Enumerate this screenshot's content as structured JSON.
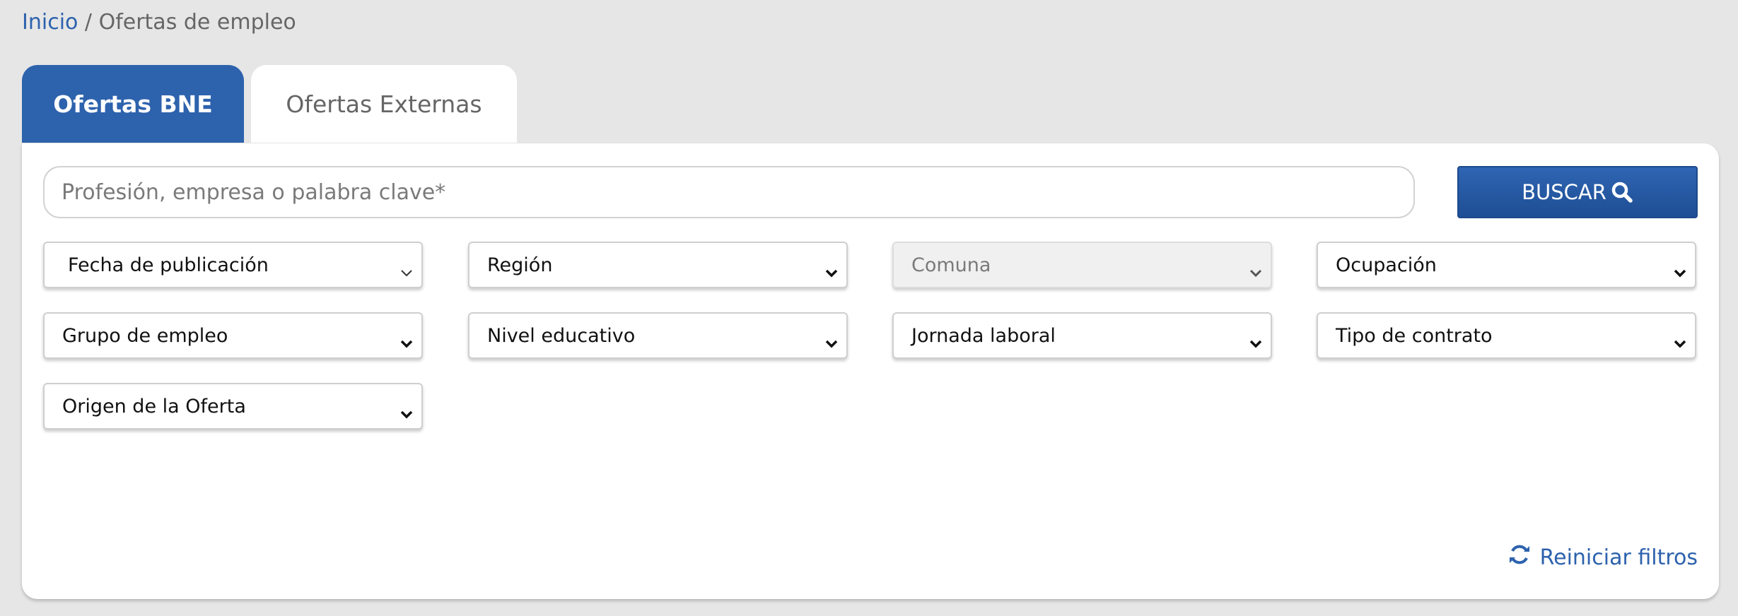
{
  "breadcrumb": {
    "home": "Inicio",
    "separator": " / ",
    "current": "Ofertas de empleo"
  },
  "tabs": [
    {
      "label": "Ofertas BNE",
      "active": true
    },
    {
      "label": "Ofertas Externas",
      "active": false
    }
  ],
  "search": {
    "value": "",
    "placeholder": "Profesión, empresa o palabra clave*",
    "button_label": "BUSCAR",
    "button_icon": "search-icon"
  },
  "filters": [
    {
      "label": "Fecha de publicación",
      "disabled": false
    },
    {
      "label": "Región",
      "disabled": false
    },
    {
      "label": "Comuna",
      "disabled": true
    },
    {
      "label": "Ocupación",
      "disabled": false
    },
    {
      "label": "Grupo de empleo",
      "disabled": false
    },
    {
      "label": "Nivel educativo",
      "disabled": false
    },
    {
      "label": "Jornada laboral",
      "disabled": false
    },
    {
      "label": "Tipo de contrato",
      "disabled": false
    },
    {
      "label": "Origen de la Oferta",
      "disabled": false
    }
  ],
  "reset": {
    "label": "Reiniciar filtros",
    "icon": "refresh-icon"
  },
  "colors": {
    "accent": "#2d62ad",
    "button": "#1e4e94",
    "background": "#e6e6e6",
    "panel": "#ffffff",
    "disabled_field": "#f0f0f0"
  }
}
